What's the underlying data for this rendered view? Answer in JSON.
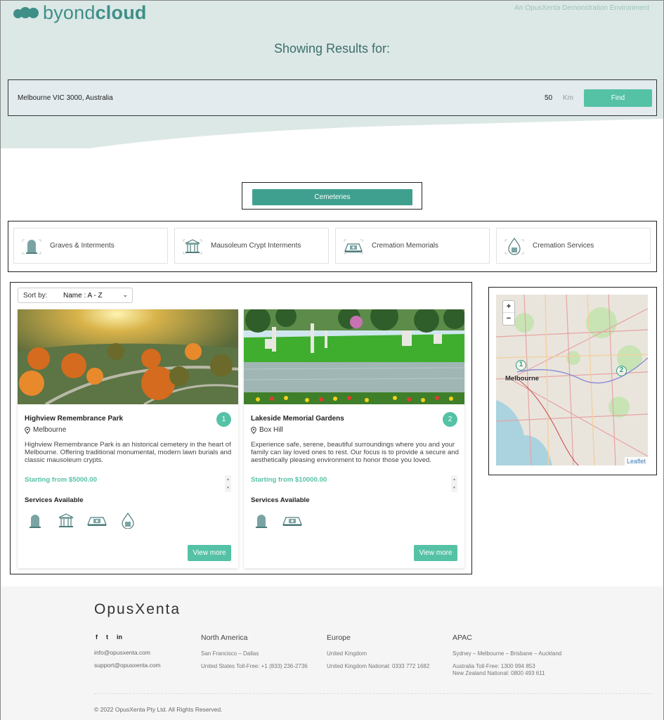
{
  "header": {
    "brand_light": "byond",
    "brand_bold": "cloud",
    "tagline": "An OpusXenta Demonstration Environment",
    "heading": "Showing Results for:"
  },
  "search": {
    "location": "Melbourne VIC 3000, Australia",
    "radius": "50",
    "unit": "Km",
    "find_label": "Find"
  },
  "category": {
    "label": "Cemeteries"
  },
  "service_filters": [
    {
      "label": "Graves & Interments",
      "icon": "grave-icon"
    },
    {
      "label": "Mausoleum Crypt Interments",
      "icon": "mausoleum-icon"
    },
    {
      "label": "Cremation Memorials",
      "icon": "cremation-memorial-icon"
    },
    {
      "label": "Cremation Services",
      "icon": "cremation-service-icon"
    }
  ],
  "sort": {
    "label": "Sort by:",
    "value": "Name : A - Z"
  },
  "results": [
    {
      "number": "1",
      "name": "Highview Remembrance Park",
      "suburb": "Melbourne",
      "description": "Highview Remembrance Park is an historical cemetery in the heart of Melbourne. Offering traditional monumental, modern lawn burials and classic mausoleum crypts.",
      "price": "Starting from $5000.00",
      "services_title": "Services Available",
      "service_icons": [
        "grave-icon",
        "mausoleum-icon",
        "cremation-memorial-icon",
        "cremation-service-icon"
      ],
      "button": "View more"
    },
    {
      "number": "2",
      "name": "Lakeside Memorial Gardens",
      "suburb": "Box Hill",
      "description": "Experience safe, serene, beautiful surroundings where you and your family can lay loved ones to rest. Our focus is to provide a secure and aesthetically pleasing environment to honor those you loved.",
      "price": "Starting from $10000.00",
      "services_title": "Services Available",
      "service_icons": [
        "grave-icon",
        "cremation-memorial-icon"
      ],
      "button": "View more"
    }
  ],
  "map": {
    "zoom_in": "+",
    "zoom_out": "−",
    "city_label": "Melbourne",
    "pins": [
      "1",
      "2"
    ],
    "attribution": "Leaflet"
  },
  "footer": {
    "logo": "OpusXenta",
    "social": [
      "f",
      "t",
      "in"
    ],
    "email_info": "info@opusxenta.com",
    "email_support": "support@opusxenta.com",
    "regions": [
      {
        "title": "North America",
        "lines": [
          "San Francisco – Dallas",
          "United States Toll-Free: +1 (833) 236-2736"
        ]
      },
      {
        "title": "Europe",
        "lines": [
          "United Kingdom",
          "United Kingdom National: 0333 772 1682"
        ]
      },
      {
        "title": "APAC",
        "lines": [
          "Sydney – Melbourne – Brisbane – Auckland",
          "Australia Toll-Free: 1300 994 853",
          "New Zealand National: 0800 493 611"
        ]
      }
    ],
    "copyright": "© 2022 OpusXenta Pty Ltd. All Rights Reserved."
  }
}
